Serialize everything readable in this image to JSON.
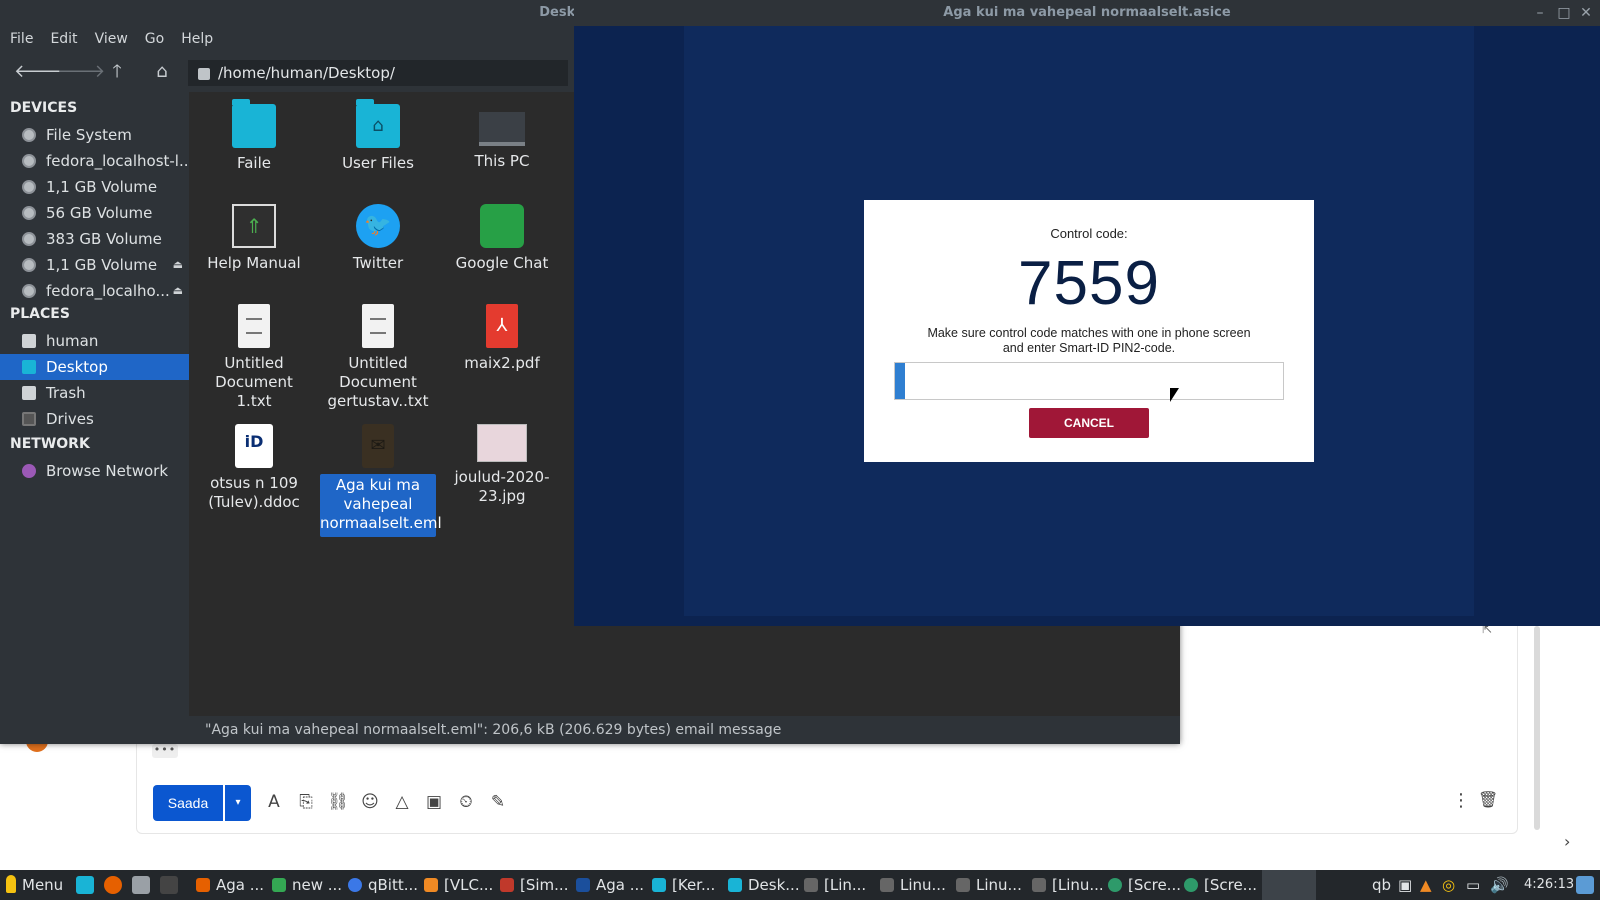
{
  "gmail": {
    "more_label": "•••",
    "send_label": "Saada",
    "send_arrow": "▾",
    "tools": [
      "A",
      "⎘",
      "⛓",
      "☺",
      "△",
      "▣",
      "⏲",
      "✎"
    ],
    "kebab": "⋮",
    "trash": "🗑",
    "chevron": "›",
    "popout": "⇱"
  },
  "fm": {
    "title": "Desktop - File",
    "menu": [
      "File",
      "Edit",
      "View",
      "Go",
      "Help"
    ],
    "nav": {
      "back": "🡐",
      "forward": "🡒",
      "up": "🡑",
      "home": "⌂"
    },
    "path": "/home/human/Desktop/",
    "sections": {
      "devices": "DEVICES",
      "places": "PLACES",
      "network": "NETWORK"
    },
    "devices": [
      {
        "label": "File System"
      },
      {
        "label": "fedora_localhost-l..."
      },
      {
        "label": "1,1 GB Volume"
      },
      {
        "label": "56 GB Volume"
      },
      {
        "label": "383 GB Volume"
      },
      {
        "label": "1,1 GB Volume",
        "eject": "⏏"
      },
      {
        "label": "fedora_localho...",
        "eject": "⏏"
      }
    ],
    "places": [
      {
        "label": "human"
      },
      {
        "label": "Desktop"
      },
      {
        "label": "Trash"
      },
      {
        "label": "Drives"
      }
    ],
    "network": [
      {
        "label": "Browse Network"
      }
    ],
    "files": [
      {
        "label": "Faile"
      },
      {
        "label": "User Files"
      },
      {
        "label": "This PC"
      },
      {
        "label": "Help Manual"
      },
      {
        "label": "Twitter"
      },
      {
        "label": "Google Chat"
      },
      {
        "label": "Untitled Document 1.txt"
      },
      {
        "label": "Untitled Document gertustav..txt"
      },
      {
        "label": "maix2.pdf"
      },
      {
        "label": "otsus n 109 (Tulev).ddoc"
      },
      {
        "label": "Aga kui ma vahepeal normaalselt.eml"
      },
      {
        "label": "joulud-2020-23.jpg"
      }
    ],
    "icon_glyphs": {
      "twitter": "🐦",
      "manual": "⇑",
      "pdf": "⅄",
      "id": "iD",
      "mail": "✉",
      "home_folder": "⌂"
    },
    "status": "\"Aga kui ma vahepeal normaalselt.eml\": 206,6 kB (206.629 bytes) email message"
  },
  "digidoc": {
    "title": "Aga kui ma vahepeal normaalselt.asice",
    "window_buttons": {
      "minimize": "–",
      "maximize": "□",
      "close": "✕"
    },
    "dialog": {
      "control_label": "Control code:",
      "control_code": "7559",
      "message_line1": "Make sure control code matches with one in phone screen",
      "message_line2": "and enter Smart-ID PIN2-code.",
      "cancel_label": "CANCEL"
    }
  },
  "taskbar": {
    "menu_label": "Menu",
    "tasks": [
      {
        "label": "Aga ...",
        "color": "#e66000"
      },
      {
        "label": "new ...",
        "color": "#34a853"
      },
      {
        "label": "qBitt...",
        "color": "#3b78e7"
      },
      {
        "label": "[VLC...",
        "color": "#f08a24"
      },
      {
        "label": "[Sim...",
        "color": "#c0392b"
      },
      {
        "label": "Aga ...",
        "color": "#1b4f9c"
      },
      {
        "label": "[Ker...",
        "color": "#19b4d6"
      },
      {
        "label": "Desk...",
        "color": "#19b4d6"
      },
      {
        "label": "[Lin...",
        "color": "#666666"
      },
      {
        "label": "Linu...",
        "color": "#666666"
      },
      {
        "label": "Linu...",
        "color": "#666666"
      },
      {
        "label": "[Linu...",
        "color": "#666666"
      },
      {
        "label": "[Scre...",
        "color": "#2e9a6a"
      },
      {
        "label": "[Scre...",
        "color": "#2e9a6a"
      }
    ],
    "tray": [
      "qb",
      "▣",
      "▲",
      "◎",
      "▭",
      "🔊"
    ],
    "clock": "4:26:13"
  }
}
